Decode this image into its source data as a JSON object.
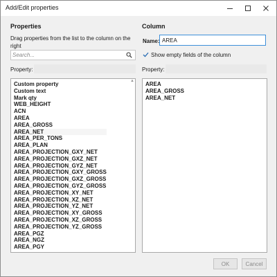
{
  "window": {
    "title": "Add/Edit properties"
  },
  "left": {
    "heading": "Properties",
    "hint": "Drag properties from the list to the column on the right",
    "search_placeholder": "Search...",
    "property_label": "Property:",
    "items": [
      "Custom property",
      "Custom text",
      "Mark qty",
      "WEB_HEIGHT",
      "ACN",
      "AREA",
      "AREA_GROSS",
      "AREA_NET",
      "AREA_PER_TONS",
      "AREA_PLAN",
      "AREA_PROJECTION_GXY_NET",
      "AREA_PROJECTION_GXZ_NET",
      "AREA_PROJECTION_GYZ_NET",
      "AREA_PROJECTION_GXY_GROSS",
      "AREA_PROJECTION_GXZ_GROSS",
      "AREA_PROJECTION_GYZ_GROSS",
      "AREA_PROJECTION_XY_NET",
      "AREA_PROJECTION_XZ_NET",
      "AREA_PROJECTION_YZ_NET",
      "AREA_PROJECTION_XY_GROSS",
      "AREA_PROJECTION_XZ_GROSS",
      "AREA_PROJECTION_YZ_GROSS",
      "AREA_PGZ",
      "AREA_NGZ",
      "AREA_PGY"
    ]
  },
  "right": {
    "heading": "Column",
    "name_label": "Name:",
    "name_value": "AREA",
    "show_empty_label": "Show empty fields of the column",
    "show_empty_checked": true,
    "property_label": "Property:",
    "items": [
      "AREA",
      "AREA_GROSS",
      "AREA_NET"
    ]
  },
  "footer": {
    "ok_label": "OK",
    "cancel_label": "Cancel"
  }
}
